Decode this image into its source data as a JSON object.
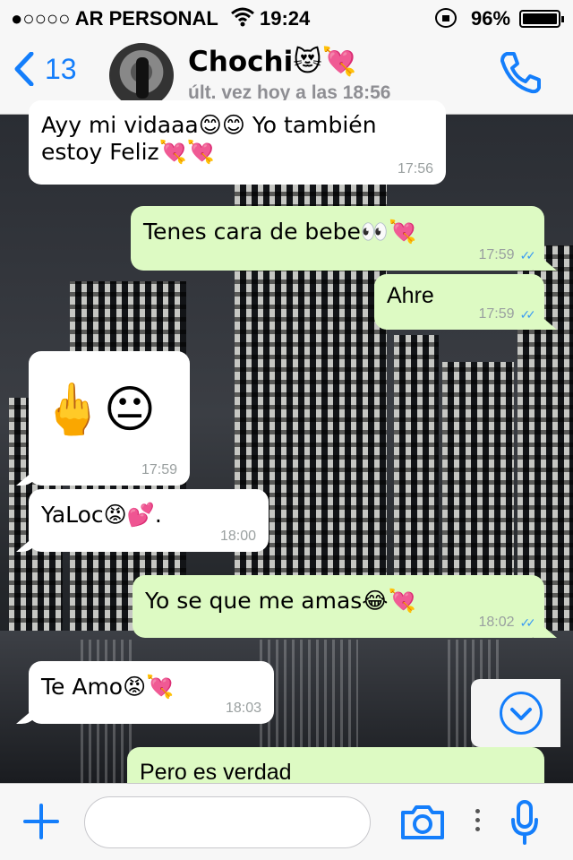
{
  "status_bar": {
    "signal": "●○○○○",
    "carrier": "AR PERSONAL",
    "time": "19:24",
    "battery": "96%",
    "icons": [
      "wifi-icon",
      "rotation-lock-icon",
      "battery-icon"
    ]
  },
  "header": {
    "back_count": "13",
    "contact_name": "Chochi😻💘",
    "last_seen": "últ. vez hoy a las 18:56",
    "accent_color": "#147efb"
  },
  "messages": [
    {
      "dir": "in",
      "text_line1": "Ayy mi vidaaa😊😊 Yo también",
      "text": "estoy Feliz💘💘",
      "time": "17:56"
    },
    {
      "dir": "out",
      "text": "Tenes cara de bebe👀💘",
      "time": "17:59"
    },
    {
      "dir": "out",
      "text": "Ahre",
      "time": "17:59"
    },
    {
      "dir": "in",
      "text": "🖕😐",
      "time": "17:59"
    },
    {
      "dir": "in",
      "text": "YaLoc😡💕.",
      "time": "18:00"
    },
    {
      "dir": "out",
      "text": "Yo se que me amas😂💘",
      "time": "18:02"
    },
    {
      "dir": "in",
      "text": "Te Amo😡💘",
      "time": "18:03"
    },
    {
      "dir": "out",
      "text": "Pero es verdad",
      "time": ""
    }
  ],
  "colors": {
    "incoming_bubble": "#ffffff",
    "outgoing_bubble": "#ddfac3",
    "read_ticks": "#3a9bf3"
  },
  "input_bar": {
    "placeholder": "",
    "icons": [
      "plus-icon",
      "camera-icon",
      "more-dots-icon",
      "microphone-icon"
    ]
  }
}
